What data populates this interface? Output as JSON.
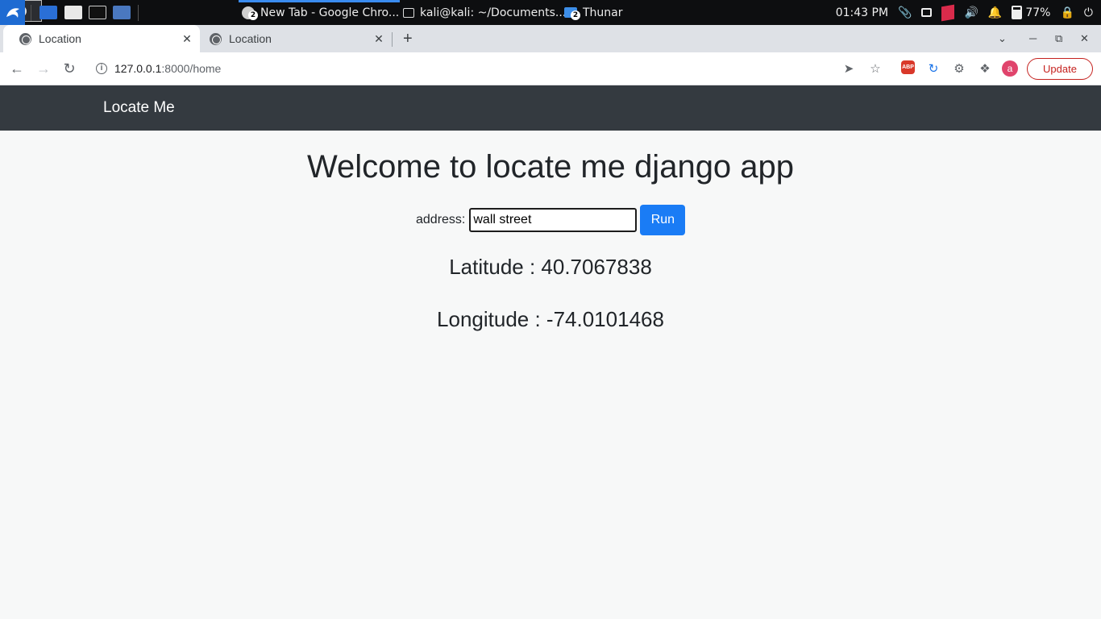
{
  "taskbar": {
    "tasks": [
      {
        "label": "New Tab - Google Chro...",
        "badge": "2"
      },
      {
        "label": "kali@kali: ~/Documents..."
      },
      {
        "label": "Thunar",
        "badge": "2"
      }
    ],
    "clock": "01:43 PM",
    "battery": "77%"
  },
  "browser": {
    "tabs": [
      {
        "title": "Location"
      },
      {
        "title": "Location"
      }
    ],
    "url_host": "127.0.0.1",
    "url_path": ":8000/home",
    "profile_initial": "a",
    "extension_label": "ABP",
    "update_label": "Update"
  },
  "page": {
    "brand": "Locate Me",
    "heading": "Welcome to locate me django app",
    "address_label": "address:",
    "address_value": "wall street",
    "run_label": "Run",
    "latitude": "Latitude : 40.7067838",
    "longitude": "Longitude : -74.0101468"
  },
  "colors": {
    "navbar": "#343a40",
    "run_button": "#1a7cf5",
    "update_button": "#c5221f"
  }
}
